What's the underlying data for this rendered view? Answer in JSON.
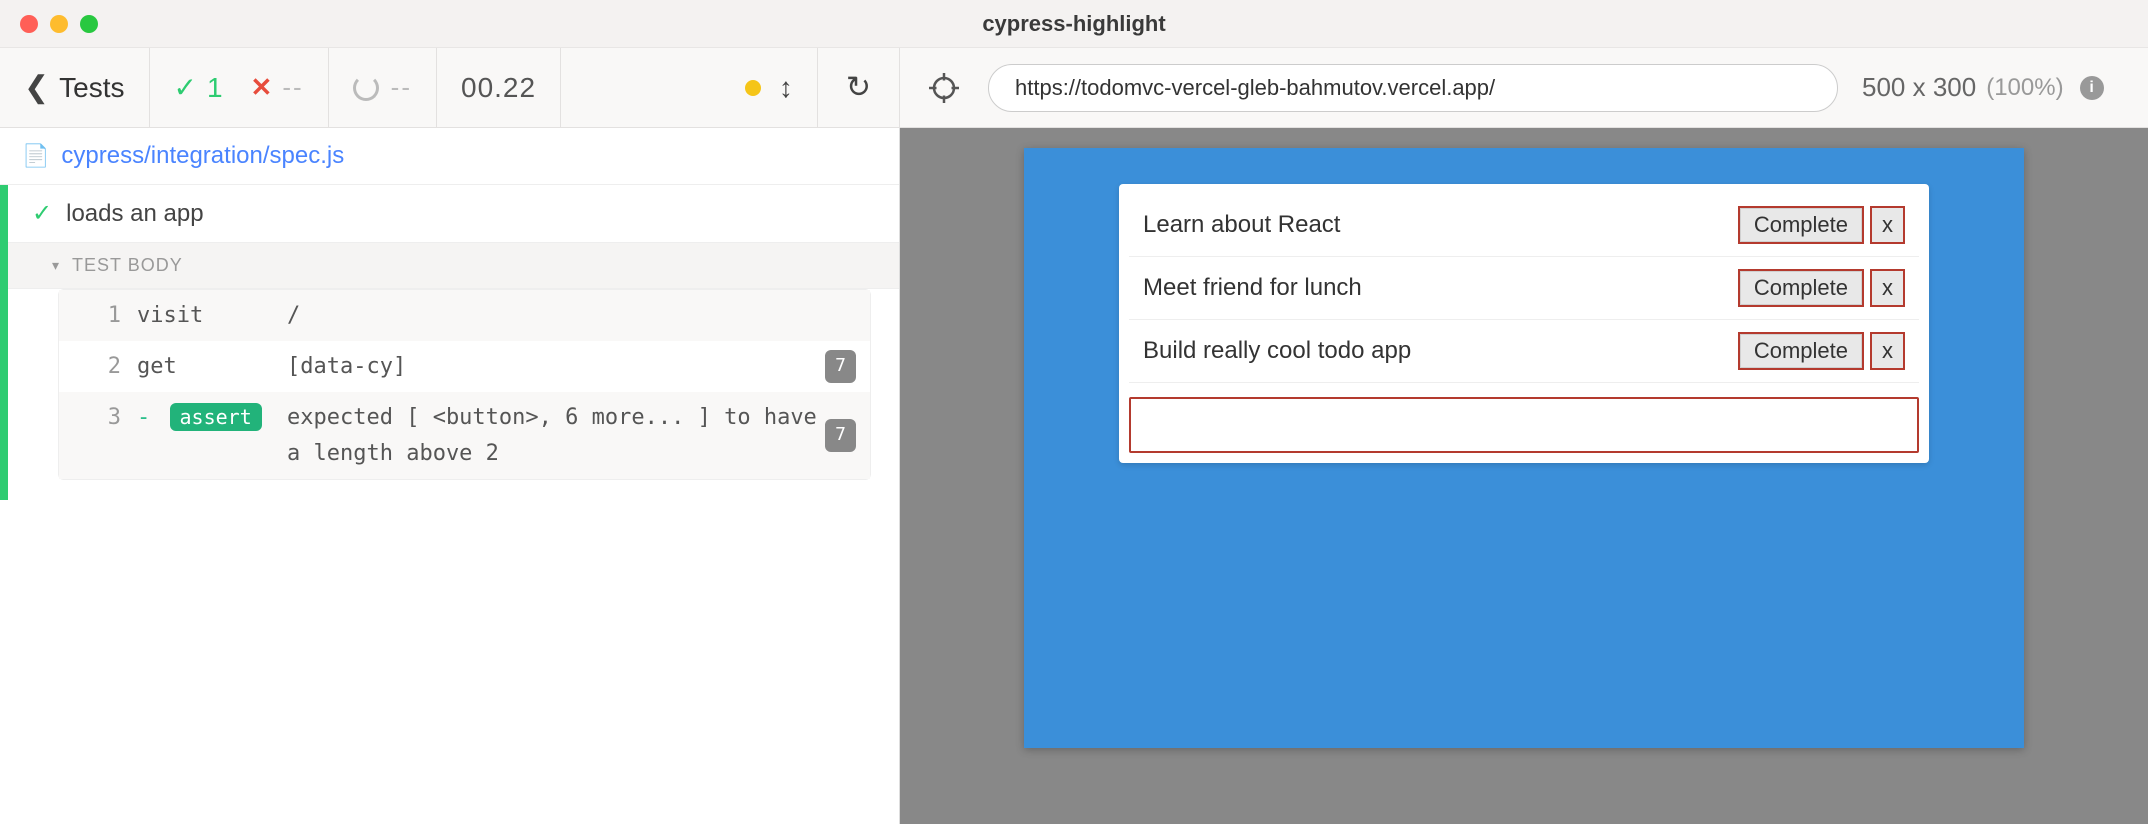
{
  "window": {
    "title": "cypress-highlight"
  },
  "toolbar": {
    "back_label": "Tests",
    "pass_count": "1",
    "fail_count": "--",
    "pending_count": "--",
    "duration": "00.22",
    "reload_icon": "reload-icon"
  },
  "aut": {
    "url": "https://todomvc-vercel-gleb-bahmutov.vercel.app/",
    "viewport": "500 x 300",
    "scale_pct": "(100%)"
  },
  "reporter": {
    "file_path": "cypress/integration/spec.js",
    "test_title": "loads an app",
    "body_label": "TEST BODY",
    "commands": [
      {
        "num": "1",
        "name": "visit",
        "message": "/",
        "badge": ""
      },
      {
        "num": "2",
        "name": "get",
        "message": "[data-cy]",
        "badge": "7"
      },
      {
        "num": "3",
        "name": "assert",
        "prefix": "-",
        "message": "expected [ <button>, 6 more... ] to have a length above 2",
        "badge": "7"
      }
    ]
  },
  "app_preview": {
    "todos": [
      {
        "text": "Learn about React",
        "complete_label": "Complete",
        "delete_label": "x"
      },
      {
        "text": "Meet friend for lunch",
        "complete_label": "Complete",
        "delete_label": "x"
      },
      {
        "text": "Build really cool todo app",
        "complete_label": "Complete",
        "delete_label": "x"
      }
    ]
  }
}
